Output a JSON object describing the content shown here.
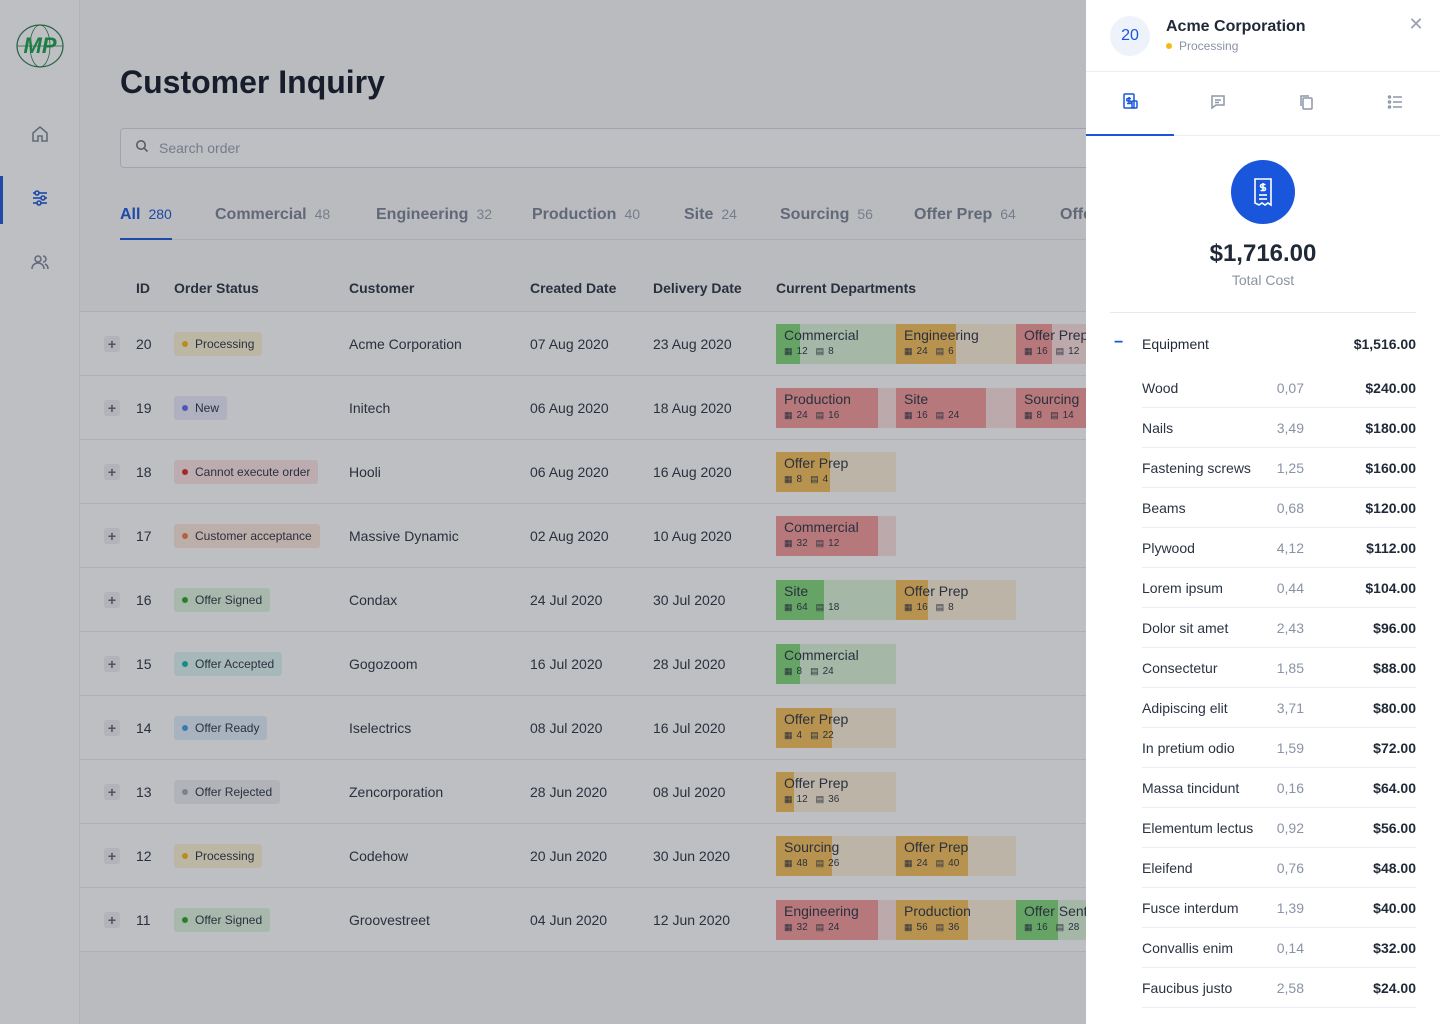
{
  "logo": {
    "text": "MP",
    "color": "#16a34a"
  },
  "sidebar": {
    "items": [
      {
        "icon": "home-icon",
        "active": false
      },
      {
        "icon": "sliders-icon",
        "active": true
      },
      {
        "icon": "users-icon",
        "active": false
      }
    ]
  },
  "page": {
    "title": "Customer Inquiry"
  },
  "search": {
    "placeholder": "Search order"
  },
  "tabs": [
    {
      "label": "All",
      "count": "280"
    },
    {
      "label": "Commercial",
      "count": "48"
    },
    {
      "label": "Engineering",
      "count": "32"
    },
    {
      "label": "Production",
      "count": "40"
    },
    {
      "label": "Site",
      "count": "24"
    },
    {
      "label": "Sourcing",
      "count": "56"
    },
    {
      "label": "Offer Prep",
      "count": "64"
    },
    {
      "label": "Offer Sent",
      "count": ""
    }
  ],
  "table": {
    "columns": [
      "ID",
      "Order Status",
      "Customer",
      "Created Date",
      "Delivery Date",
      "Current Departments"
    ],
    "rows": [
      {
        "id": "20",
        "status": "Processing",
        "customer": "Acme Corporation",
        "created": "07 Aug 2020",
        "delivery": "23 Aug 2020",
        "depts": [
          {
            "name": "Commercial",
            "a": "12",
            "b": "8",
            "progress": 0.2
          },
          {
            "name": "Engineering",
            "a": "24",
            "b": "6",
            "progress": 0.5
          },
          {
            "name": "Offer Prep",
            "a": "16",
            "b": "12",
            "progress": 0.3
          }
        ]
      },
      {
        "id": "19",
        "status": "New",
        "customer": "Initech",
        "created": "06 Aug 2020",
        "delivery": "18 Aug 2020",
        "depts": [
          {
            "name": "Production",
            "a": "24",
            "b": "16",
            "progress": 0.85
          },
          {
            "name": "Site",
            "a": "16",
            "b": "24",
            "progress": 0.75
          },
          {
            "name": "Sourcing",
            "a": "8",
            "b": "14",
            "progress": 0.6
          }
        ]
      },
      {
        "id": "18",
        "status": "Cannot execute order",
        "customer": "Hooli",
        "created": "06 Aug 2020",
        "delivery": "16 Aug 2020",
        "depts": [
          {
            "name": "Offer Prep",
            "a": "8",
            "b": "4",
            "progress": 0.45
          }
        ]
      },
      {
        "id": "17",
        "status": "Customer acceptance",
        "customer": "Massive Dynamic",
        "created": "02 Aug 2020",
        "delivery": "10 Aug 2020",
        "depts": [
          {
            "name": "Commercial",
            "a": "32",
            "b": "12",
            "progress": 0.85
          }
        ]
      },
      {
        "id": "16",
        "status": "Offer Signed",
        "customer": "Condax",
        "created": "24 Jul 2020",
        "delivery": "30 Jul 2020",
        "depts": [
          {
            "name": "Site",
            "a": "64",
            "b": "18",
            "progress": 0.4
          },
          {
            "name": "Offer Prep",
            "a": "16",
            "b": "8",
            "progress": 0.27
          }
        ]
      },
      {
        "id": "15",
        "status": "Offer Accepted",
        "customer": "Gogozoom",
        "created": "16 Jul 2020",
        "delivery": "28 Jul 2020",
        "depts": [
          {
            "name": "Commercial",
            "a": "8",
            "b": "24",
            "progress": 0.2
          }
        ]
      },
      {
        "id": "14",
        "status": "Offer Ready",
        "customer": "Iselectrics",
        "created": "08 Jul 2020",
        "delivery": "16 Jul 2020",
        "depts": [
          {
            "name": "Offer Prep",
            "a": "4",
            "b": "22",
            "progress": 0.47
          }
        ]
      },
      {
        "id": "13",
        "status": "Offer Rejected",
        "customer": "Zencorporation",
        "created": "28 Jun 2020",
        "delivery": "08 Jul 2020",
        "depts": [
          {
            "name": "Offer Prep",
            "a": "12",
            "b": "36",
            "progress": 0.15
          }
        ]
      },
      {
        "id": "12",
        "status": "Processing",
        "customer": "Codehow",
        "created": "20 Jun 2020",
        "delivery": "30 Jun 2020",
        "depts": [
          {
            "name": "Sourcing",
            "a": "48",
            "b": "26",
            "progress": 0.47
          },
          {
            "name": "Offer Prep",
            "a": "24",
            "b": "40",
            "progress": 0.6
          }
        ]
      },
      {
        "id": "11",
        "status": "Offer Signed",
        "customer": "Groovestreet",
        "created": "04 Jun 2020",
        "delivery": "12 Jun 2020",
        "depts": [
          {
            "name": "Engineering",
            "a": "32",
            "b": "24",
            "progress": 0.85
          },
          {
            "name": "Production",
            "a": "56",
            "b": "36",
            "progress": 0.6
          },
          {
            "name": "Offer Sent",
            "a": "16",
            "b": "28",
            "progress": 0.35
          }
        ]
      }
    ]
  },
  "status_colors": {
    "Processing": {
      "bg": "#fdf3d4",
      "dot": "#f5b90f"
    },
    "New": {
      "bg": "#eaeafd",
      "dot": "#6366f1"
    },
    "Cannot execute order": {
      "bg": "#fde4e4",
      "dot": "#dc2626"
    },
    "Customer acceptance": {
      "bg": "#fde7dc",
      "dot": "#f07b4a"
    },
    "Offer Signed": {
      "bg": "#e1f5e0",
      "dot": "#22a822"
    },
    "Offer Accepted": {
      "bg": "#dff5f4",
      "dot": "#14b8a6"
    },
    "Offer Ready": {
      "bg": "#e0eefb",
      "dot": "#38a3e0"
    },
    "Offer Rejected": {
      "bg": "#eceef1",
      "dot": "#a0a7b4"
    }
  },
  "dept_colors": {
    "Commercial": {
      "bg": "#dcf5d8",
      "fill": "#82d87a"
    },
    "Site": {
      "bg": "#dcf5d8",
      "fill": "#82d87a"
    },
    "Offer Sent": {
      "bg": "#dcf5d8",
      "fill": "#82d87a"
    },
    "Engineering": {
      "bg": "#fdf0d8",
      "fill": "#f7c15c"
    },
    "Offer Prep": {
      "bg": "#fdf0d8",
      "fill": "#f7c15c"
    },
    "Sourcing": {
      "bg": "#fdf0d8",
      "fill": "#f7c15c"
    },
    "Production": {
      "bg": "#fdf0d8",
      "fill": "#f7c15c"
    },
    "red": {
      "bg": "#fde0e0",
      "fill": "#f59a9a"
    }
  },
  "red_depts": [
    "19:Production",
    "19:Site",
    "19:Sourcing",
    "17:Commercial",
    "11:Engineering",
    "20:Offer Prep"
  ],
  "panel": {
    "id": "20",
    "customer": "Acme Corporation",
    "status": "Processing",
    "close_icon": "close-icon",
    "tabs": [
      "invoice-icon",
      "comments-icon",
      "copy-icon",
      "list-icon"
    ],
    "total": "$1,716.00",
    "total_label": "Total Cost",
    "category": {
      "name": "Equipment",
      "amount": "$1,516.00"
    },
    "items": [
      {
        "name": "Wood",
        "qty": "0,07",
        "amount": "$240.00"
      },
      {
        "name": "Nails",
        "qty": "3,49",
        "amount": "$180.00"
      },
      {
        "name": "Fastening screws",
        "qty": "1,25",
        "amount": "$160.00"
      },
      {
        "name": "Beams",
        "qty": "0,68",
        "amount": "$120.00"
      },
      {
        "name": "Plywood",
        "qty": "4,12",
        "amount": "$112.00"
      },
      {
        "name": "Lorem ipsum",
        "qty": "0,44",
        "amount": "$104.00"
      },
      {
        "name": "Dolor sit amet",
        "qty": "2,43",
        "amount": "$96.00"
      },
      {
        "name": "Consectetur",
        "qty": "1,85",
        "amount": "$88.00"
      },
      {
        "name": "Adipiscing elit",
        "qty": "3,71",
        "amount": "$80.00"
      },
      {
        "name": "In pretium odio",
        "qty": "1,59",
        "amount": "$72.00"
      },
      {
        "name": "Massa tincidunt",
        "qty": "0,16",
        "amount": "$64.00"
      },
      {
        "name": "Elementum lectus",
        "qty": "0,92",
        "amount": "$56.00"
      },
      {
        "name": "Eleifend",
        "qty": "0,76",
        "amount": "$48.00"
      },
      {
        "name": "Fusce interdum",
        "qty": "1,39",
        "amount": "$40.00"
      },
      {
        "name": "Convallis enim",
        "qty": "0,14",
        "amount": "$32.00"
      },
      {
        "name": "Faucibus justo",
        "qty": "2,58",
        "amount": "$24.00"
      }
    ]
  }
}
